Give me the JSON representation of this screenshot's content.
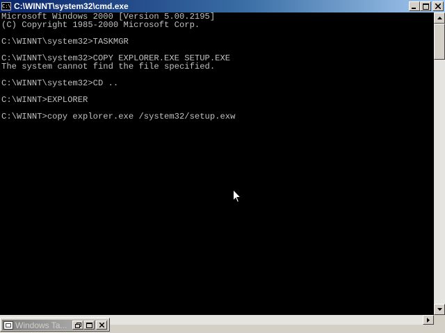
{
  "window": {
    "title": "C:\\WINNT\\system32\\cmd.exe",
    "icon_label": "C:\\"
  },
  "console": {
    "lines": [
      "Microsoft Windows 2000 [Version 5.00.2195]",
      "(C) Copyright 1985-2000 Microsoft Corp.",
      "",
      "C:\\WINNT\\system32>TASKMGR",
      "",
      "C:\\WINNT\\system32>COPY EXPLORER.EXE SETUP.EXE",
      "The system cannot find the file specified.",
      "",
      "C:\\WINNT\\system32>CD ..",
      "",
      "C:\\WINNT>EXPLORER",
      "",
      "C:\\WINNT>copy explorer.exe /system32/setup.exw"
    ]
  },
  "minimized_window": {
    "title": "Windows Ta..."
  },
  "colors": {
    "console_bg": "#000000",
    "console_text": "#c0c0c0",
    "titlebar_active": "#0a246a",
    "titlebar_inactive": "#808080"
  }
}
